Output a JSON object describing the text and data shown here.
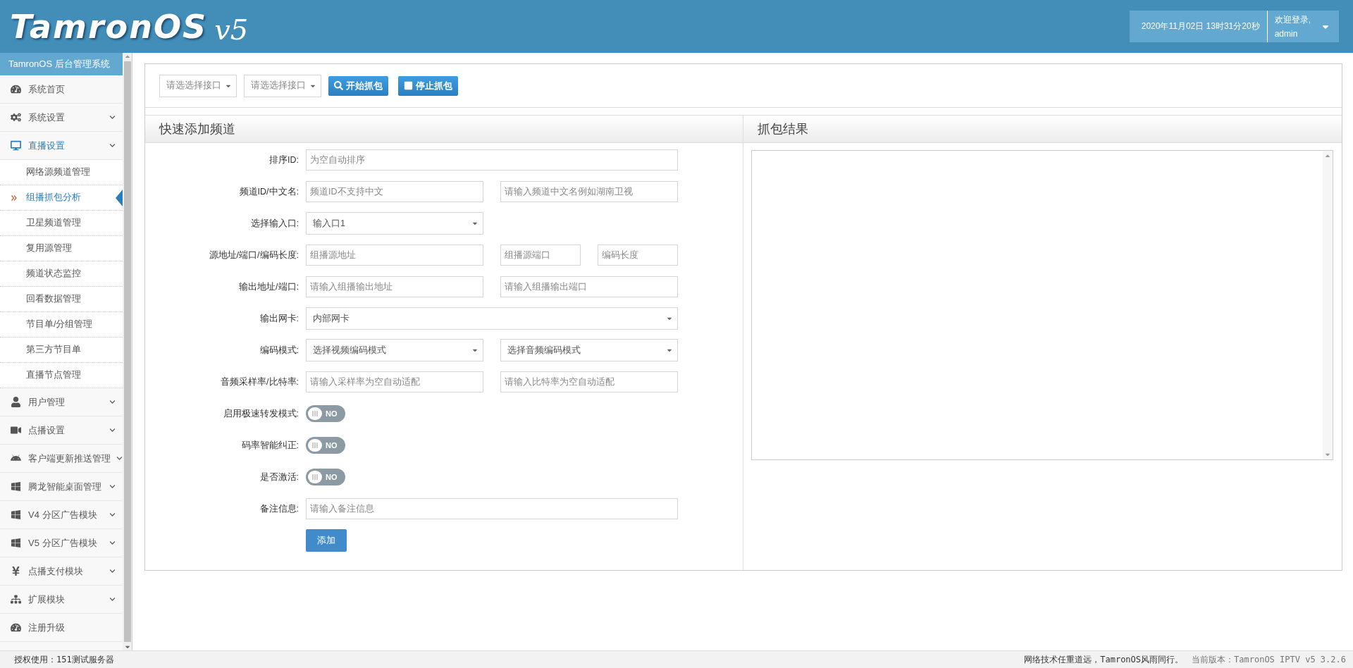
{
  "header": {
    "logo": "TamronOS",
    "logo_version": "v5",
    "datetime": "2020年11月02日 13时31分20秒",
    "welcome": "欢迎登录,",
    "user": "admin"
  },
  "sidebar": {
    "title": "TamronOS 后台管理系统",
    "items": [
      {
        "label": "系统首页",
        "expandable": false,
        "expanded": false
      },
      {
        "label": "系统设置",
        "expandable": true,
        "expanded": false
      },
      {
        "label": "直播设置",
        "expandable": true,
        "expanded": true,
        "children": [
          {
            "label": "网络源频道管理",
            "selected": false
          },
          {
            "label": "组播抓包分析",
            "selected": true
          },
          {
            "label": "卫星频道管理",
            "selected": false
          },
          {
            "label": "复用源管理",
            "selected": false
          },
          {
            "label": "频道状态监控",
            "selected": false
          },
          {
            "label": "回看数据管理",
            "selected": false
          },
          {
            "label": "节目单/分组管理",
            "selected": false
          },
          {
            "label": "第三方节目单",
            "selected": false
          },
          {
            "label": "直播节点管理",
            "selected": false
          }
        ]
      },
      {
        "label": "用户管理",
        "expandable": true,
        "expanded": false
      },
      {
        "label": "点播设置",
        "expandable": true,
        "expanded": false
      },
      {
        "label": "客户端更新推送管理",
        "expandable": true,
        "expanded": false
      },
      {
        "label": "腾龙智能桌面管理",
        "expandable": true,
        "expanded": false
      },
      {
        "label": "V4 分区广告模块",
        "expandable": true,
        "expanded": false
      },
      {
        "label": "V5 分区广告模块",
        "expandable": true,
        "expanded": false
      },
      {
        "label": "点播支付模块",
        "expandable": true,
        "expanded": false
      },
      {
        "label": "扩展模块",
        "expandable": true,
        "expanded": false
      },
      {
        "label": "注册升级",
        "expandable": false,
        "expanded": false
      }
    ]
  },
  "toolbar": {
    "selects": [
      {
        "placeholder": "请选选择接口"
      },
      {
        "placeholder": "请选选择接口"
      }
    ],
    "buttons": [
      {
        "label": "开始抓包",
        "kind": "search"
      },
      {
        "label": "停止抓包",
        "kind": "stop"
      }
    ]
  },
  "form_panel": {
    "title": "快速添加频道",
    "rows": [
      {
        "label": "排序ID:",
        "kind": "fields",
        "fields": [
          {
            "kind": "wide_input",
            "placeholder": "为空自动排序"
          }
        ]
      },
      {
        "label": "频道ID/中文名:",
        "kind": "fields",
        "fields": [
          {
            "kind": "input",
            "placeholder": "频道ID不支持中文"
          },
          {
            "kind": "input",
            "placeholder": "请输入频道中文名例如湖南卫视"
          }
        ]
      },
      {
        "label": "选择输入口:",
        "kind": "fields",
        "fields": [
          {
            "kind": "select",
            "value": "输入口1"
          }
        ]
      },
      {
        "label": "源地址/端口/编码长度:",
        "kind": "fields",
        "fields": [
          {
            "kind": "input",
            "placeholder": "组播源地址"
          },
          {
            "kind": "short_input",
            "placeholder": "组播源端口"
          },
          {
            "kind": "short_input",
            "placeholder": "编码长度"
          }
        ]
      },
      {
        "label": "输出地址/端口:",
        "kind": "fields",
        "fields": [
          {
            "kind": "input",
            "placeholder": "请输入组播输出地址"
          },
          {
            "kind": "input",
            "placeholder": "请输入组播输出端口"
          }
        ]
      },
      {
        "label": "输出网卡:",
        "kind": "fields",
        "fields": [
          {
            "kind": "wide_select",
            "value": "内部网卡"
          }
        ]
      },
      {
        "label": "编码模式:",
        "kind": "fields",
        "fields": [
          {
            "kind": "select",
            "value": "选择视频编码模式"
          },
          {
            "kind": "select",
            "value": "选择音频编码模式"
          }
        ]
      },
      {
        "label": "音频采样率/比特率:",
        "kind": "fields",
        "fields": [
          {
            "kind": "input",
            "placeholder": "请输入采样率为空自动适配"
          },
          {
            "kind": "input",
            "placeholder": "请输入比特率为空自动适配"
          }
        ]
      },
      {
        "label": "启用极速转发模式:",
        "kind": "toggle",
        "on": false,
        "text": "NO"
      },
      {
        "label": "码率智能纠正:",
        "kind": "toggle",
        "on": false,
        "text": "NO"
      },
      {
        "label": "是否激活:",
        "kind": "toggle",
        "on": false,
        "text": "NO"
      },
      {
        "label": "备注信息:",
        "kind": "fields",
        "fields": [
          {
            "kind": "wide_input",
            "placeholder": "请输入备注信息"
          }
        ]
      }
    ],
    "submit": "添加"
  },
  "result_panel": {
    "title": "抓包结果"
  },
  "footer": {
    "license": "授权使用：151测试服务器",
    "slogan": "网络技术任重道远，TamronOS风雨同行。",
    "version": "当前版本：TamronOS IPTV v5 3.2.6"
  }
}
